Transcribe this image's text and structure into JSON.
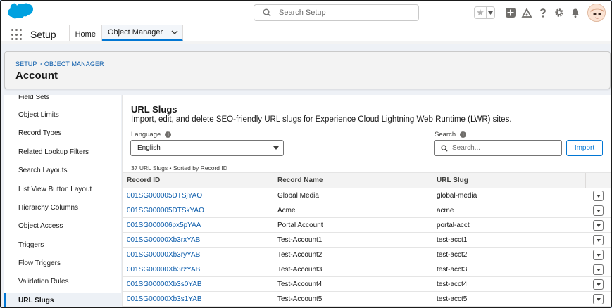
{
  "global_header": {
    "search_placeholder": "Search Setup"
  },
  "app_nav": {
    "app_name": "Setup",
    "tabs": [
      {
        "label": "Home"
      },
      {
        "label": "Object Manager"
      }
    ]
  },
  "page_header": {
    "breadcrumb": "SETUP > OBJECT MANAGER",
    "title": "Account"
  },
  "sidebar": {
    "items": [
      {
        "label": "Field Sets"
      },
      {
        "label": "Object Limits"
      },
      {
        "label": "Record Types"
      },
      {
        "label": "Related Lookup Filters"
      },
      {
        "label": "Search Layouts"
      },
      {
        "label": "List View Button Layout"
      },
      {
        "label": "Hierarchy Columns"
      },
      {
        "label": "Object Access"
      },
      {
        "label": "Triggers"
      },
      {
        "label": "Flow Triggers"
      },
      {
        "label": "Validation Rules"
      },
      {
        "label": "URL Slugs"
      }
    ],
    "active_label": "URL Slugs"
  },
  "main": {
    "title": "URL Slugs",
    "description": "Import, edit, and delete SEO-friendly URL slugs for Experience Cloud Lightning Web Runtime (LWR) sites.",
    "language_label": "Language",
    "language_value": "English",
    "search_label": "Search",
    "search_placeholder": "Search...",
    "import_label": "Import",
    "count_text": "37 URL Slugs • Sorted by Record ID",
    "columns": [
      "Record ID",
      "Record Name",
      "URL Slug"
    ],
    "rows": [
      {
        "id": "001SG000005DTSjYAO",
        "name": "Global Media",
        "slug": "global-media"
      },
      {
        "id": "001SG000005DTSkYAO",
        "name": "Acme",
        "slug": "acme"
      },
      {
        "id": "001SG000006px5pYAA",
        "name": "Portal Account",
        "slug": "portal-acct"
      },
      {
        "id": "001SG00000Xb3rxYAB",
        "name": "Test-Account1",
        "slug": "test-acct1"
      },
      {
        "id": "001SG00000Xb3ryYAB",
        "name": "Test-Account2",
        "slug": "test-acct2"
      },
      {
        "id": "001SG00000Xb3rzYAB",
        "name": "Test-Account3",
        "slug": "test-acct3"
      },
      {
        "id": "001SG00000Xb3s0YAB",
        "name": "Test-Account4",
        "slug": "test-acct4"
      },
      {
        "id": "001SG00000Xb3s1YAB",
        "name": "Test-Account5",
        "slug": "test-acct5"
      }
    ]
  },
  "colors": {
    "brand": "#00a1e0",
    "link": "#0b5cab",
    "accent": "#0176d3"
  },
  "icons": [
    "salesforce-cloud-logo",
    "search-icon",
    "star-icon",
    "add-icon",
    "trailhead-icon",
    "help-icon",
    "gear-icon",
    "bell-icon",
    "waffle-icon",
    "chevron-down-icon",
    "info-icon"
  ]
}
